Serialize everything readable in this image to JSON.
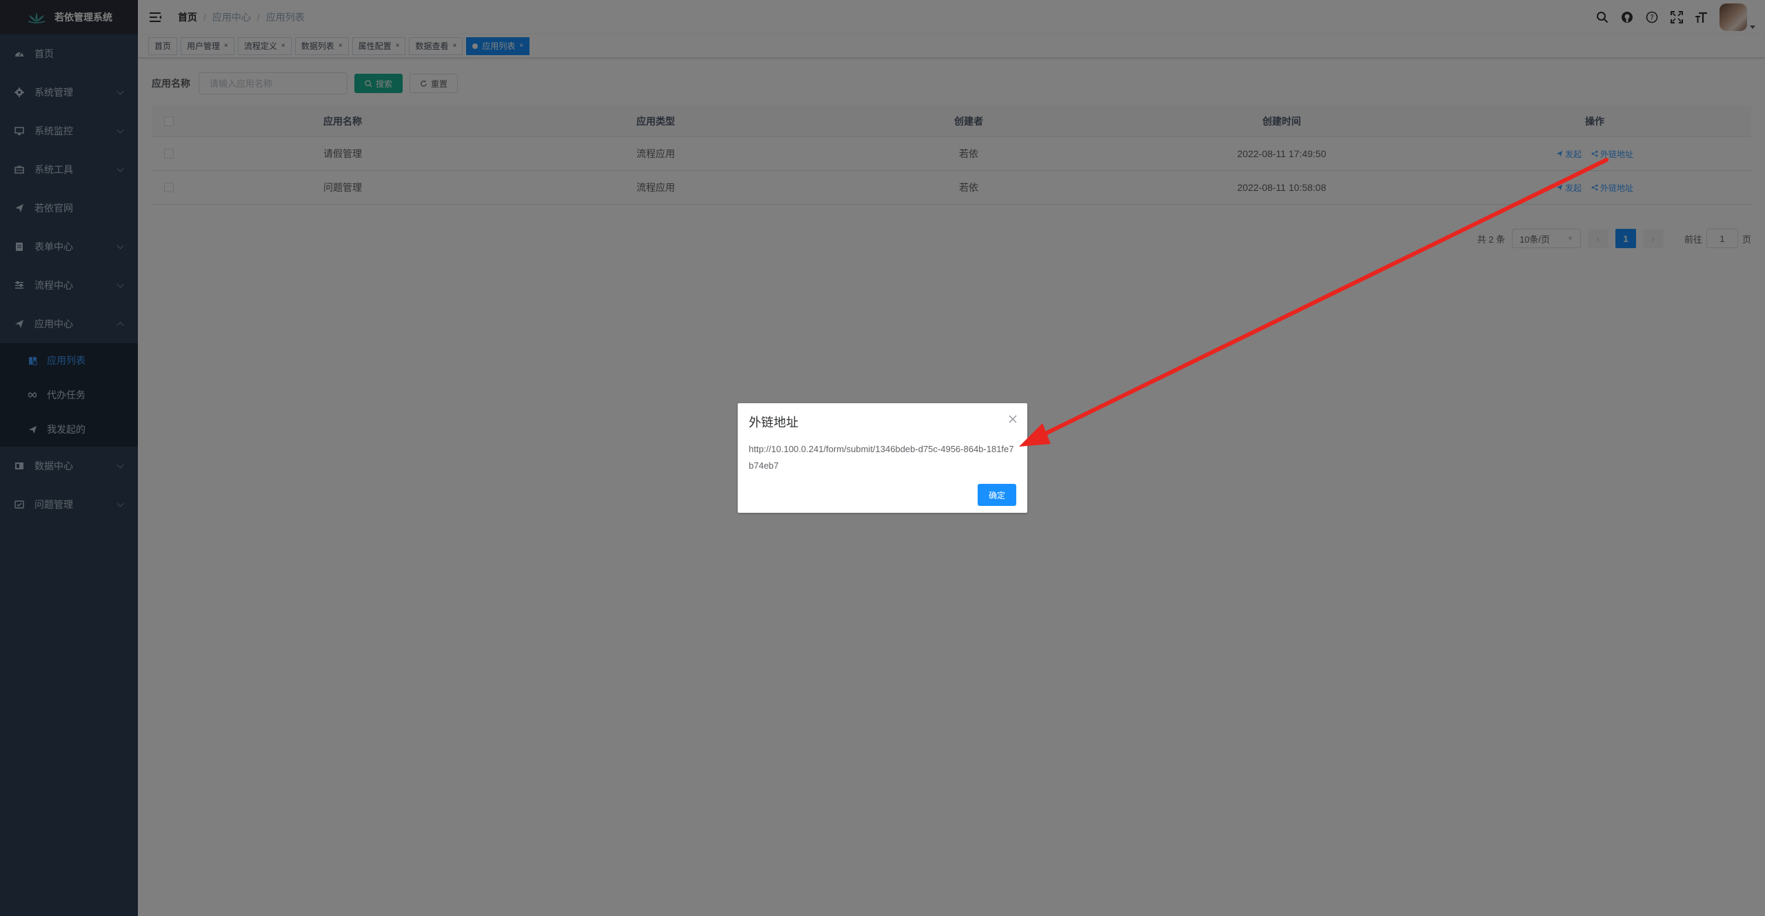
{
  "app": {
    "title": "若依管理系统"
  },
  "sidebar": {
    "items": [
      {
        "label": "首页",
        "icon": "dashboard-icon"
      },
      {
        "label": "系统管理",
        "icon": "gear-icon"
      },
      {
        "label": "系统监控",
        "icon": "monitor-icon"
      },
      {
        "label": "系统工具",
        "icon": "toolbox-icon"
      },
      {
        "label": "若依官网",
        "icon": "send-icon"
      },
      {
        "label": "表单中心",
        "icon": "form-icon"
      },
      {
        "label": "流程中心",
        "icon": "sliders-icon"
      },
      {
        "label": "应用中心",
        "icon": "send-icon"
      }
    ],
    "sub_items": [
      {
        "label": "应用列表",
        "icon": "app-list-icon",
        "active": true
      },
      {
        "label": "代办任务",
        "icon": "infinity-icon"
      },
      {
        "label": "我发起的",
        "icon": "send-icon"
      }
    ],
    "items_after": [
      {
        "label": "数据中心",
        "icon": "data-icon"
      },
      {
        "label": "问题管理",
        "icon": "question-icon"
      }
    ]
  },
  "breadcrumb": [
    "首页",
    "应用中心",
    "应用列表"
  ],
  "tags": [
    {
      "label": "首页"
    },
    {
      "label": "用户管理"
    },
    {
      "label": "流程定义"
    },
    {
      "label": "数据列表"
    },
    {
      "label": "属性配置"
    },
    {
      "label": "数据查看"
    },
    {
      "label": "应用列表",
      "active": true
    }
  ],
  "search": {
    "label": "应用名称",
    "placeholder": "请输入应用名称",
    "search_button": "搜索",
    "reset_button": "重置"
  },
  "table": {
    "columns": [
      "应用名称",
      "应用类型",
      "创建者",
      "创建时间",
      "操作"
    ],
    "rows": [
      {
        "name": "请假管理",
        "type": "流程应用",
        "creator": "若依",
        "time": "2022-08-11 17:49:50",
        "op1": "发起",
        "op2": "外链地址"
      },
      {
        "name": "问题管理",
        "type": "流程应用",
        "creator": "若依",
        "time": "2022-08-11 10:58:08",
        "op1": "发起",
        "op2": "外链地址"
      }
    ]
  },
  "pagination": {
    "total": "共 2 条",
    "page_size": "10条/页",
    "current_page": "1",
    "goto_label": "前往",
    "goto_value": "1",
    "page_suffix": "页"
  },
  "dialog": {
    "title": "外链地址",
    "url": "http://10.100.0.241/form/submit/1346bdeb-d75c-4956-864b-181fe7b74eb7",
    "confirm_button": "确定"
  },
  "colors": {
    "sidebar_bg": "#304156",
    "primary": "#1890ff",
    "search_button": "#1ab394",
    "annotation_arrow": "#e8251f"
  }
}
